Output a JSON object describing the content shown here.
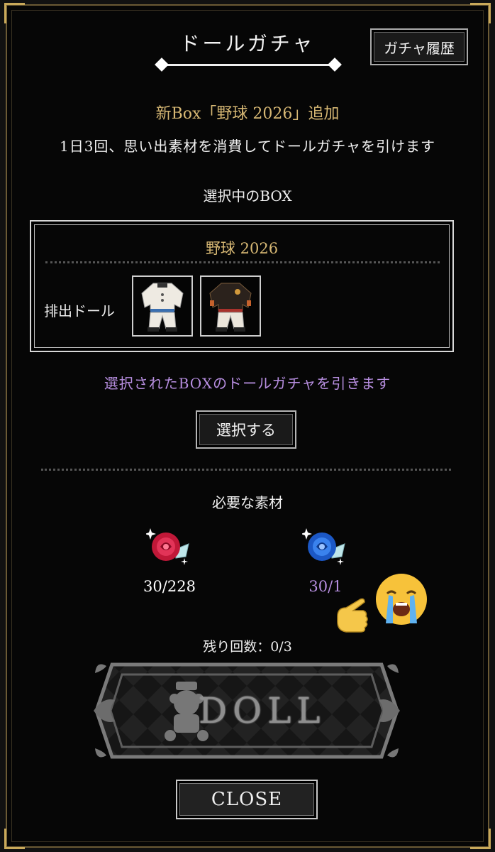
{
  "header": {
    "title": "ドールガチャ",
    "history_button": "ガチャ履歴"
  },
  "notice": {
    "new_box": "新Box「野球 2026」追加",
    "description": "1日3回、思い出素材を消費してドールガチャを引けます"
  },
  "selected_box": {
    "section_label": "選択中のBOX",
    "name": "野球 2026",
    "dolls_label": "排出ドール",
    "dolls": [
      {
        "icon": "white-baseball-uniform-icon"
      },
      {
        "icon": "black-baseball-uniform-icon"
      }
    ]
  },
  "select": {
    "note": "選択されたBOXのドールガチャを引きます",
    "button": "選択する"
  },
  "materials": {
    "label": "必要な素材",
    "items": [
      {
        "icon": "red-rose-icon",
        "count": "30/228",
        "color": "#ffffff"
      },
      {
        "icon": "blue-rose-icon",
        "count": "30/1",
        "color": "#b78ee0"
      }
    ]
  },
  "remaining": "残り回数：0/3",
  "doll_button": {
    "label": "DOLL"
  },
  "close_button": "CLOSE",
  "stickers": {
    "crying_emoji": "😭",
    "pointing_emoji": "☝️"
  }
}
